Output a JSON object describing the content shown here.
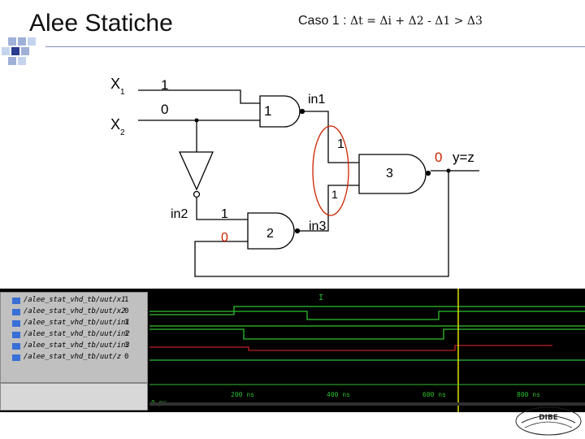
{
  "slide": {
    "title": "Alee Statiche",
    "caso_prefix": "Caso 1 : ",
    "caso_formula": "Δt = Δi + Δ2 - Δ1 > Δ3"
  },
  "circuit": {
    "labels": {
      "x1_main": "X",
      "x1_sub": "1",
      "x2_main": "X",
      "x2_sub": "2",
      "x1_value": "1",
      "x2_value": "0",
      "gate1_number": "1",
      "in1": "in1",
      "in1_value": "1",
      "gate3_number": "3",
      "output_value": "0",
      "output_label": "y=z",
      "gate3_in_bottom_value": "1",
      "in2": "in2",
      "in2_value": "1",
      "gate2_in_bottom_value": "0",
      "gate2_number": "2",
      "in3": "in3"
    },
    "colors": {
      "highlight": "#cc2200",
      "wire": "#000000"
    }
  },
  "waveform": {
    "signals": [
      {
        "name": "/alee_stat_vhd_tb/uut/x1",
        "value": "1"
      },
      {
        "name": "/alee_stat_vhd_tb/uut/x2",
        "value": "0"
      },
      {
        "name": "/alee_stat_vhd_tb/uut/in1",
        "value": "1"
      },
      {
        "name": "/alee_stat_vhd_tb/uut/in2",
        "value": "1"
      },
      {
        "name": "/alee_stat_vhd_tb/uut/in3",
        "value": "1"
      },
      {
        "name": "/alee_stat_vhd_tb/uut/z",
        "value": "0"
      }
    ],
    "time_labels": [
      "0 ps",
      "200 ns",
      "400 ns",
      "600 ns",
      "800 ns"
    ],
    "cursor_label": "I",
    "colors": {
      "trace": "#30c030",
      "cursor": "#e0e000",
      "in3_trace": "#c02020",
      "background": "#000000"
    }
  },
  "logo": {
    "text": "DIBE"
  }
}
